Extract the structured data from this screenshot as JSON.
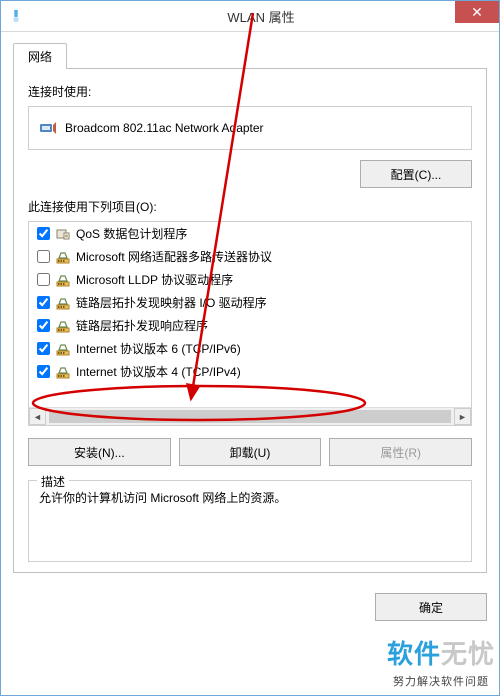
{
  "window": {
    "title": "WLAN 属性",
    "close_glyph": "✕"
  },
  "tab": {
    "label": "网络"
  },
  "connect_using_label": "连接时使用:",
  "adapter": {
    "name": "Broadcom 802.11ac Network Adapter"
  },
  "buttons": {
    "configure": "配置(C)...",
    "install": "安装(N)...",
    "uninstall": "卸载(U)",
    "properties": "属性(R)",
    "ok": "确定"
  },
  "items_label": "此连接使用下列项目(O):",
  "items": [
    {
      "checked": true,
      "icon": "qos",
      "label": "QoS 数据包计划程序"
    },
    {
      "checked": false,
      "icon": "proto",
      "label": "Microsoft 网络适配器多路传送器协议"
    },
    {
      "checked": false,
      "icon": "proto",
      "label": "Microsoft LLDP 协议驱动程序"
    },
    {
      "checked": true,
      "icon": "proto",
      "label": "链路层拓扑发现映射器 I/O 驱动程序"
    },
    {
      "checked": true,
      "icon": "proto",
      "label": "链路层拓扑发现响应程序"
    },
    {
      "checked": true,
      "icon": "proto",
      "label": "Internet 协议版本 6 (TCP/IPv6)"
    },
    {
      "checked": true,
      "icon": "proto",
      "label": "Internet 协议版本 4 (TCP/IPv4)"
    }
  ],
  "desc": {
    "legend": "描述",
    "text": "允许你的计算机访问 Microsoft 网络上的资源。"
  },
  "watermark": {
    "brand_a": "软件",
    "brand_b": "无忧",
    "tagline": "努力解决软件问题"
  },
  "annotation": {
    "circled_item_index": 6
  }
}
